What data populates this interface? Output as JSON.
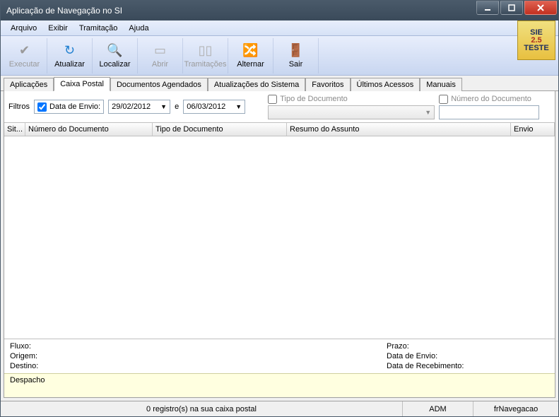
{
  "window": {
    "title": "Aplicação de Navegação no SI"
  },
  "menu": {
    "arquivo": "Arquivo",
    "exibir": "Exibir",
    "tramitacao": "Tramitação",
    "ajuda": "Ajuda"
  },
  "logo": {
    "l1": "SIE",
    "l2": "2.5",
    "l3": "TESTE"
  },
  "toolbar": {
    "executar": "Executar",
    "atualizar": "Atualizar",
    "localizar": "Localizar",
    "abrir": "Abrir",
    "tramitacoes": "Tramitações",
    "alternar": "Alternar",
    "sair": "Sair"
  },
  "tabs": {
    "aplicacoes": "Aplicações",
    "caixa": "Caixa Postal",
    "docs": "Documentos Agendados",
    "atual": "Atualizações do Sistema",
    "fav": "Favoritos",
    "ult": "Últimos Acessos",
    "man": "Manuais"
  },
  "filters": {
    "label": "Filtros",
    "dataenvio": "Data de Envio:",
    "date1": "29/02/2012",
    "e": "e",
    "date2": "06/03/2012",
    "tipodoc": "Tipo de Documento",
    "numdoc": "Número do Documento"
  },
  "grid": {
    "sit": "Sit...",
    "num": "Número do Documento",
    "tipo": "Tipo de Documento",
    "resumo": "Resumo do Assunto",
    "envio": "Envio"
  },
  "detail": {
    "fluxo": "Fluxo:",
    "origem": "Origem:",
    "destino": "Destino:",
    "prazo": "Prazo:",
    "dataenvio": "Data de Envio:",
    "datarec": "Data de Recebimento:",
    "despacho": "Despacho"
  },
  "status": {
    "msg": "0 registro(s) na sua caixa postal",
    "user": "ADM",
    "form": "frNavegacao"
  }
}
